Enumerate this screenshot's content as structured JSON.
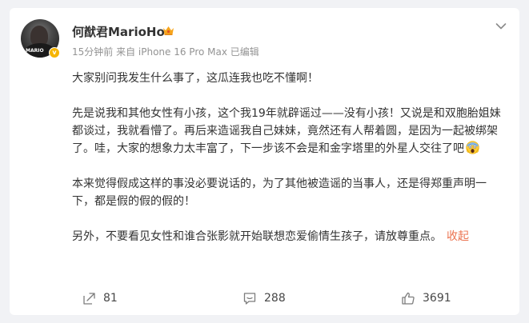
{
  "post": {
    "author": {
      "name": "何猷君MarioHo"
    },
    "meta": "15分钟前 来自 iPhone 16 Pro Max 已编辑",
    "avatar_text": "MARIO",
    "paragraphs": [
      "大家别问我发生什么事了，这瓜连我也吃不懂啊！",
      "先是说我和其他女性有小孩，这个我19年就辟谣过——没有小孩！又说是和双胞胎姐妹都谈过，我就看懵了。再后来造谣我自己妹妹，竟然还有人帮着圆，是因为一起被绑架了。哇，大家的想象力太丰富了，下一步该不会是和金字塔里的外星人交往了吧",
      "本来觉得假成这样的事没必要说话的，为了其他被造谣的当事人，还是得郑重声明一下，都是假的假的假的！",
      "另外，不要看见女性和谁合张影就开始联想恋爱偷情生孩子，请放尊重点。"
    ],
    "collapse_label": "收起",
    "actions": {
      "repost_count": "81",
      "comment_count": "288",
      "like_count": "3691"
    },
    "icons": [
      "crown-icon",
      "verified-badge-icon",
      "more-chevron-icon",
      "scream-emoji",
      "repost-icon",
      "comment-icon",
      "like-icon"
    ],
    "colors": {
      "accent": "#eb7350",
      "badge": "#f6b500",
      "text": "#333333",
      "meta": "#939393"
    }
  }
}
